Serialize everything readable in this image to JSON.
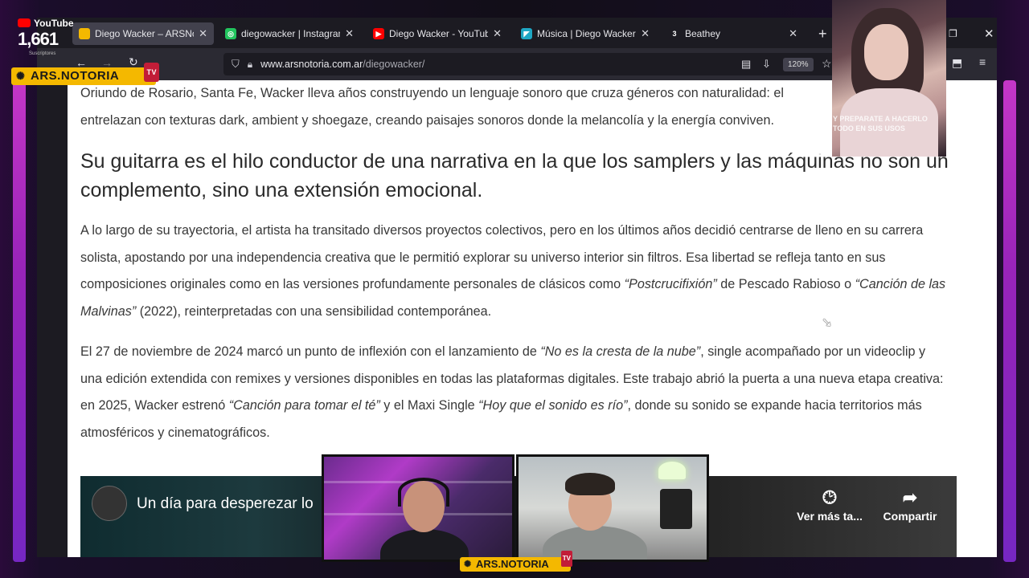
{
  "overlay": {
    "youtube_label": "YouTube",
    "subscriber_count": "1,661",
    "subscriber_caption": "Suscriptores",
    "brand": "ARS.NOTORIA",
    "brand_tv": "TV",
    "webcam_caption": "Y PREPARATE A HACERLO TODO EN SUS USOS"
  },
  "browser": {
    "tabs": [
      {
        "title": "Diego Wacker – ARSNotoria",
        "active": true,
        "favicon_color": "#f4b800",
        "favicon_glyph": ""
      },
      {
        "title": "diegowacker | Instagram, |",
        "active": false,
        "favicon_color": "#22c55e",
        "favicon_glyph": "◎"
      },
      {
        "title": "Diego Wacker - YouTube",
        "active": false,
        "favicon_color": "#ff0000",
        "favicon_glyph": "▶"
      },
      {
        "title": "Música | Diego Wacker",
        "active": false,
        "favicon_color": "#1fa7c4",
        "favicon_glyph": "◤"
      },
      {
        "title": "Beathey",
        "active": false,
        "favicon_color": "#1c1b22",
        "favicon_glyph": "3"
      }
    ],
    "new_tab_icon": "plus-icon",
    "url_host": "www.arsnotoria.com.ar",
    "url_path": "/diegowacker/",
    "zoom": "120%"
  },
  "article": {
    "paragraph1": "Oriundo de Rosario, Santa Fe, Wacker lleva años construyendo un lenguaje sonoro que cruza géneros con naturalidad: el",
    "paragraph1b": "entrelazan con texturas dark, ambient y shoegaze, creando paisajes sonoros donde la melancolía y la energía conviven.",
    "heading": "Su guitarra es el hilo conductor de una narrativa en la que los samplers y las máquinas no son un complemento, sino una extensión emocional.",
    "paragraph2_a": "A lo largo de su trayectoria, el artista ha transitado diversos proyectos colectivos, pero en los últimos años decidió centrarse de lleno en su carrera solista, apostando por una independencia creativa que le permitió explorar su universo interior sin filtros. Esa libertad se refleja tanto en sus composiciones originales como en las versiones profundamente personales de clásicos como ",
    "paragraph2_em1": "“Postcrucifixión”",
    "paragraph2_b": " de Pescado Rabioso o ",
    "paragraph2_em2": "“Canción de las Malvinas”",
    "paragraph2_c": " (2022), reinterpretadas con una sensibilidad contemporánea.",
    "paragraph3_a": "El 27 de noviembre de 2024 marcó un punto de inflexión con el lanzamiento de ",
    "paragraph3_em1": "“No es la cresta de la nube”",
    "paragraph3_b": ", single acompañado por un videoclip y una edición extendida con remixes y versiones disponibles en todas las plataformas digitales. Este trabajo abrió la puerta a una nueva etapa creativa: en 2025, Wacker estrenó ",
    "paragraph3_em2": "“Canción para tomar el té”",
    "paragraph3_c": " y el Maxi Single ",
    "paragraph3_em3": "“Hoy que el sonido es río”",
    "paragraph3_d": ", donde su sonido se expande hacia territorios más atmosféricos y cinematográficos."
  },
  "video": {
    "title": "Un día para desperezar lo",
    "watch_later": "Ver más ta...",
    "share": "Compartir"
  }
}
